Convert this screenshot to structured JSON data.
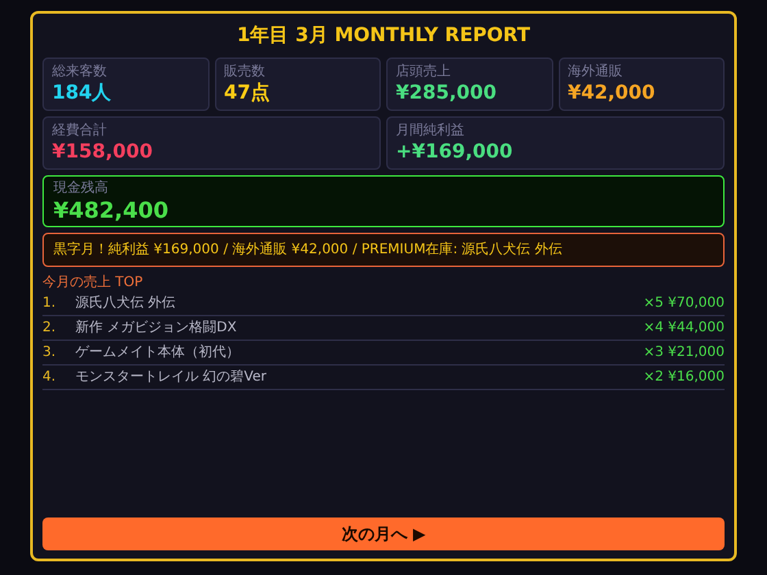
{
  "title": "1年目 3月  MONTHLY REPORT",
  "stats": [
    {
      "label": "総来客数",
      "value": "184人",
      "color": "#22d3ee"
    },
    {
      "label": "販売数",
      "value": "47点",
      "color": "#facc15"
    },
    {
      "label": "店頭売上",
      "value": "¥285,000",
      "color": "#4ade80"
    },
    {
      "label": "海外通販",
      "value": "¥42,000",
      "color": "#f5a524"
    },
    {
      "label": "経費合計",
      "value": "¥158,000",
      "color": "#f43f5e"
    },
    {
      "label": "月間純利益",
      "value": "+¥169,000",
      "color": "#4ade80"
    }
  ],
  "cash": {
    "label": "現金残高",
    "value": "¥482,400"
  },
  "banner": "黒字月！純利益 ¥169,000 / 海外通販 ¥42,000 / PREMIUM在庫: 源氏八犬伝 外伝",
  "top_sales": {
    "heading": "今月の売上 TOP",
    "rows": [
      {
        "rank": "1.",
        "name": "源氏八犬伝 外伝",
        "result": "×5 ¥70,000"
      },
      {
        "rank": "2.",
        "name": "新作 メガビジョン格闘DX",
        "result": "×4 ¥44,000"
      },
      {
        "rank": "3.",
        "name": "ゲームメイト本体（初代）",
        "result": "×3 ¥21,000"
      },
      {
        "rank": "4.",
        "name": "モンスタートレイル 幻の碧Ver",
        "result": "×2 ¥16,000"
      }
    ]
  },
  "next_button": "次の月へ ▶"
}
